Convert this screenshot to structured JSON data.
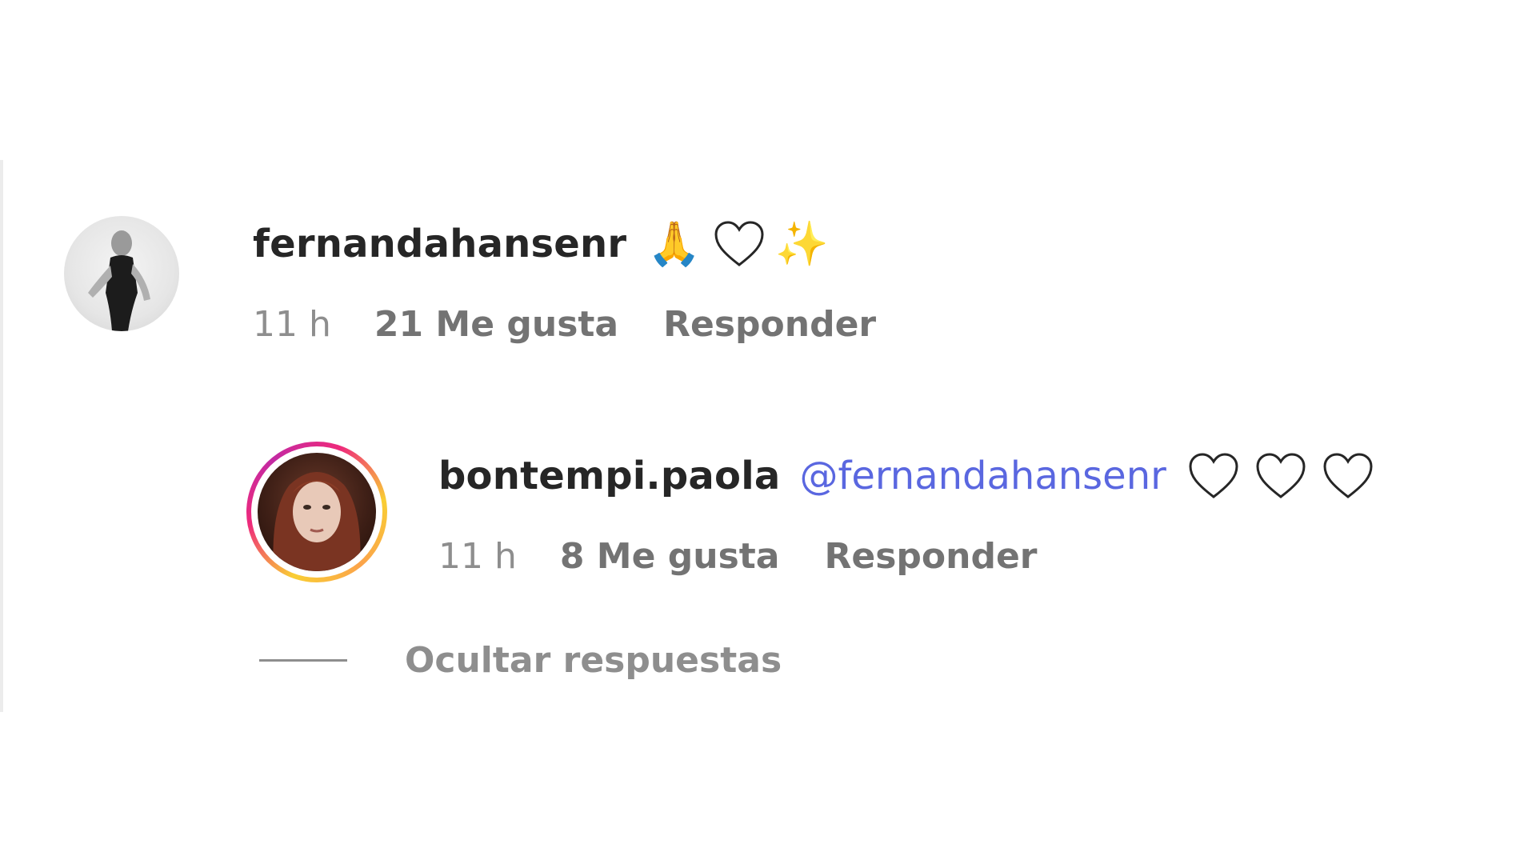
{
  "comment": {
    "username": "fernandahansenr",
    "emojis": [
      "🙏",
      "✨"
    ],
    "time": "11 h",
    "likes": "21 Me gusta",
    "reply_label": "Responder"
  },
  "reply": {
    "username": "bontempi.paola",
    "mention": "@fernandahansenr",
    "time": "11 h",
    "likes": "8 Me gusta",
    "reply_label": "Responder"
  },
  "hide_replies_label": "Ocultar respuestas"
}
